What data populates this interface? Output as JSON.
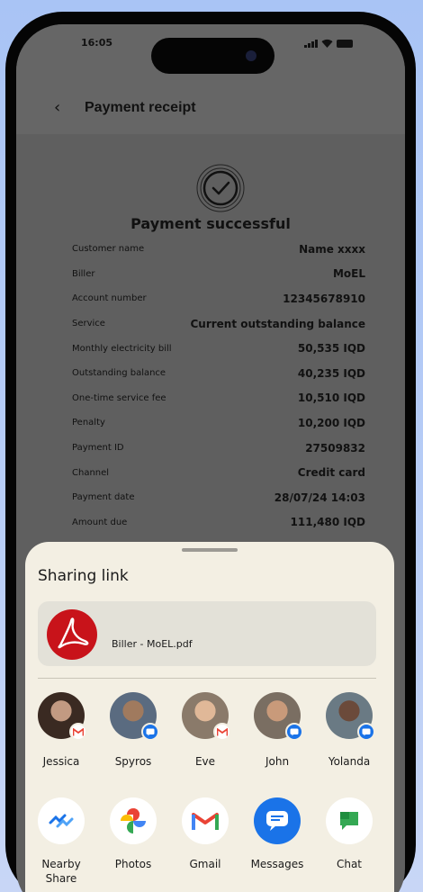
{
  "status_bar": {
    "time": "16:05"
  },
  "header": {
    "back_glyph": "‹",
    "title": "Payment receipt"
  },
  "status": {
    "title": "Payment successful"
  },
  "receipt_rows": [
    {
      "label": "Customer name",
      "value": "Name xxxx"
    },
    {
      "label": "Biller",
      "value": "MoEL"
    },
    {
      "label": "Account number",
      "value": "12345678910"
    },
    {
      "label": "Service",
      "value": "Current outstanding balance"
    },
    {
      "label": "Monthly electricity bill",
      "value": "50,535 IQD"
    },
    {
      "label": "Outstanding balance",
      "value": "40,235 IQD"
    },
    {
      "label": "One-time service fee",
      "value": "10,510 IQD"
    },
    {
      "label": "Penalty",
      "value": "10,200 IQD"
    },
    {
      "label": "Payment ID",
      "value": "27509832"
    },
    {
      "label": "Channel",
      "value": "Credit card"
    },
    {
      "label": "Payment date",
      "value": "28/07/24 14:03"
    },
    {
      "label": "Amount due",
      "value": "111,480 IQD"
    }
  ],
  "share_sheet": {
    "title": "Sharing link",
    "file_name": "Biller - MoEL.pdf",
    "file_icon": "acrobat-icon",
    "contacts": [
      {
        "name": "Jessica",
        "badge": "gmail-icon",
        "color": "#3a2a22"
      },
      {
        "name": "Spyros",
        "badge": "messages-icon",
        "color": "#5a6b80"
      },
      {
        "name": "Eve",
        "badge": "gmail-icon",
        "color": "#8a7a6a"
      },
      {
        "name": "John",
        "badge": "messages-icon",
        "color": "#7a6e62"
      },
      {
        "name": "Yolanda",
        "badge": "messages-icon",
        "color": "#6a7a84"
      }
    ],
    "apps": [
      {
        "name": "Nearby\nShare",
        "icon": "nearby-share-icon"
      },
      {
        "name": "Photos",
        "icon": "photos-icon"
      },
      {
        "name": "Gmail",
        "icon": "gmail-icon"
      },
      {
        "name": "Messages",
        "icon": "messages-icon"
      },
      {
        "name": "Chat",
        "icon": "chat-icon"
      }
    ]
  }
}
